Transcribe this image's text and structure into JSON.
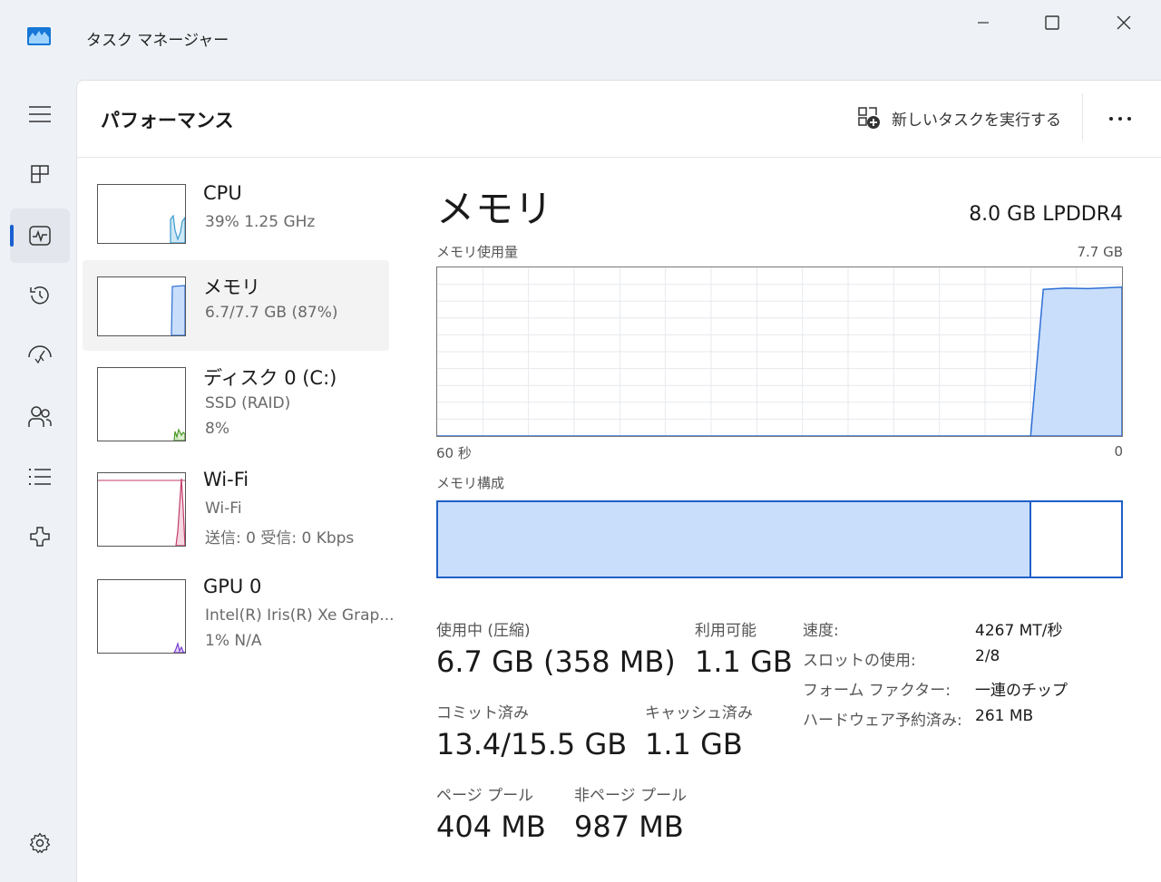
{
  "window": {
    "title": "タスク マネージャー",
    "minimize_icon": "minimize-icon",
    "maximize_icon": "maximize-icon",
    "close_icon": "close-icon"
  },
  "nav": {
    "items": [
      {
        "icon": "hamburger-menu-icon"
      },
      {
        "icon": "processes-icon"
      },
      {
        "icon": "performance-icon",
        "active": true
      },
      {
        "icon": "app-history-icon"
      },
      {
        "icon": "startup-apps-icon"
      },
      {
        "icon": "users-icon"
      },
      {
        "icon": "details-list-icon"
      },
      {
        "icon": "services-icon"
      }
    ],
    "settings_icon": "settings-gear-icon"
  },
  "header": {
    "title": "パフォーマンス",
    "run_task_label": "新しいタスクを実行する",
    "more_icon": "more-options-icon"
  },
  "devices": [
    {
      "name": "CPU",
      "line1": "39%  1.25 GHz",
      "line2": "",
      "color": "#3a9bd0",
      "fill": "#cfe8f6"
    },
    {
      "name": "メモリ",
      "line1": "6.7/7.7 GB (87%)",
      "line2": "",
      "color": "#2e6fd6",
      "fill": "#c9defa",
      "selected": true
    },
    {
      "name": "ディスク 0 (C:)",
      "line1": "SSD (RAID)",
      "line2": "8%",
      "color": "#4b9a2a",
      "fill": "#dcefcf"
    },
    {
      "name": "Wi-Fi",
      "line1": "Wi-Fi",
      "line2": "送信: 0  受信: 0 Kbps",
      "color": "#c43d6a",
      "fill": "#f6d6e1"
    },
    {
      "name": "GPU 0",
      "line1": "Intel(R) Iris(R) Xe Grap...",
      "line2": "1%  N/A",
      "color": "#7a3fd0",
      "fill": "#e2d4f6"
    }
  ],
  "memory": {
    "title": "メモリ",
    "type": "8.0 GB LPDDR4",
    "usage_label": "メモリ使用量",
    "usage_max": "7.7 GB",
    "time_left": "60 秒",
    "time_right": "0",
    "composition_label": "メモリ構成",
    "composition_in_use_fraction": 0.866,
    "stats": {
      "in_use_label": "使用中 (圧縮)",
      "in_use_value": "6.7 GB (358 MB)",
      "available_label": "利用可能",
      "available_value": "1.1 GB",
      "committed_label": "コミット済み",
      "committed_value": "13.4/15.5 GB",
      "cached_label": "キャッシュ済み",
      "cached_value": "1.1 GB",
      "paged_label": "ページ プール",
      "paged_value": "404 MB",
      "nonpaged_label": "非ページ プール",
      "nonpaged_value": "987 MB"
    },
    "specs": {
      "speed_label": "速度:",
      "speed_value": "4267 MT/秒",
      "slots_label": "スロットの使用:",
      "slots_value": "2/8",
      "form_label": "フォーム ファクター:",
      "form_value": "一連のチップ",
      "reserved_label": "ハードウェア予約済み:",
      "reserved_value": "261 MB"
    }
  },
  "chart_data": {
    "type": "area",
    "title": "",
    "xlabel": "",
    "ylabel": "",
    "xlim": [
      60,
      0
    ],
    "ylim": [
      0,
      7.7
    ],
    "grid": true,
    "x": [
      60,
      8,
      6.9,
      5,
      3,
      0
    ],
    "values": [
      0,
      0,
      6.7,
      6.75,
      6.73,
      6.8
    ]
  }
}
